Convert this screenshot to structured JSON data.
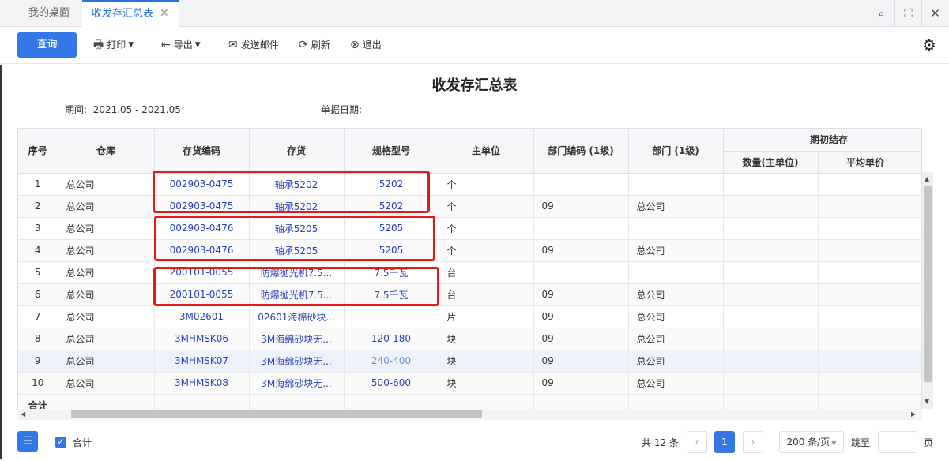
{
  "tabs": [
    {
      "label": "我的桌面"
    },
    {
      "label": "收发存汇总表",
      "close": "✕"
    }
  ],
  "topbar_icons": [
    "search-icon",
    "fullscreen-icon",
    "close-icon"
  ],
  "toolbar": {
    "query": "查询",
    "print": "打印",
    "export": "导出",
    "send_mail": "发送邮件",
    "refresh": "刷新",
    "exit": "退出"
  },
  "report": {
    "title": "收发存汇总表",
    "period_label": "期间:",
    "period_value": "2021.05 - 2021.05",
    "doc_date_label": "单据日期:"
  },
  "table": {
    "headers": {
      "index": "序号",
      "warehouse": "仓库",
      "code": "存货编码",
      "item": "存货",
      "spec": "规格型号",
      "unit": "主单位",
      "dept_code": "部门编码 (1级)",
      "dept": "部门 (1级)",
      "opening": "期初结存",
      "qty": "数量(主单位)",
      "avg_price": "平均单价"
    },
    "rows": [
      {
        "idx": "1",
        "wh": "总公司",
        "code": "002903-0475",
        "item": "轴承5202",
        "spec": "5202",
        "unit": "个",
        "dcode": "",
        "dept": ""
      },
      {
        "idx": "2",
        "wh": "总公司",
        "code": "002903-0475",
        "item": "轴承5202",
        "spec": "5202",
        "unit": "个",
        "dcode": "09",
        "dept": "总公司"
      },
      {
        "idx": "3",
        "wh": "总公司",
        "code": "002903-0476",
        "item": "轴承5205",
        "spec": "5205",
        "unit": "个",
        "dcode": "",
        "dept": ""
      },
      {
        "idx": "4",
        "wh": "总公司",
        "code": "002903-0476",
        "item": "轴承5205",
        "spec": "5205",
        "unit": "个",
        "dcode": "09",
        "dept": "总公司"
      },
      {
        "idx": "5",
        "wh": "总公司",
        "code": "200101-0055",
        "item": "防爆抛光机7.5...",
        "spec": "7.5千瓦",
        "unit": "台",
        "dcode": "",
        "dept": ""
      },
      {
        "idx": "6",
        "wh": "总公司",
        "code": "200101-0055",
        "item": "防爆抛光机7.5...",
        "spec": "7.5千瓦",
        "unit": "台",
        "dcode": "09",
        "dept": "总公司"
      },
      {
        "idx": "7",
        "wh": "总公司",
        "code": "3M02601",
        "item": "02601海棉砂块...",
        "spec": "",
        "unit": "片",
        "dcode": "09",
        "dept": "总公司"
      },
      {
        "idx": "8",
        "wh": "总公司",
        "code": "3MHMSK06",
        "item": "3M海绵砂块无...",
        "spec": "120-180",
        "unit": "块",
        "dcode": "09",
        "dept": "总公司"
      },
      {
        "idx": "9",
        "wh": "总公司",
        "code": "3MHMSK07",
        "item": "3M海绵砂块无...",
        "spec": "240-400",
        "unit": "块",
        "dcode": "09",
        "dept": "总公司"
      },
      {
        "idx": "10",
        "wh": "总公司",
        "code": "3MHMSK08",
        "item": "3M海绵砂块无...",
        "spec": "500-600",
        "unit": "块",
        "dcode": "09",
        "dept": "总公司"
      }
    ],
    "total_label": "合计"
  },
  "footer": {
    "total_checkbox_label": "合计",
    "count": "共 12 条",
    "page": "1",
    "page_size": "200 条/页",
    "jump_label": "跳至",
    "page_unit": "页"
  },
  "colors": {
    "accent": "#3478e5",
    "link": "#2a3fc0",
    "highlight": "#e5191c"
  }
}
